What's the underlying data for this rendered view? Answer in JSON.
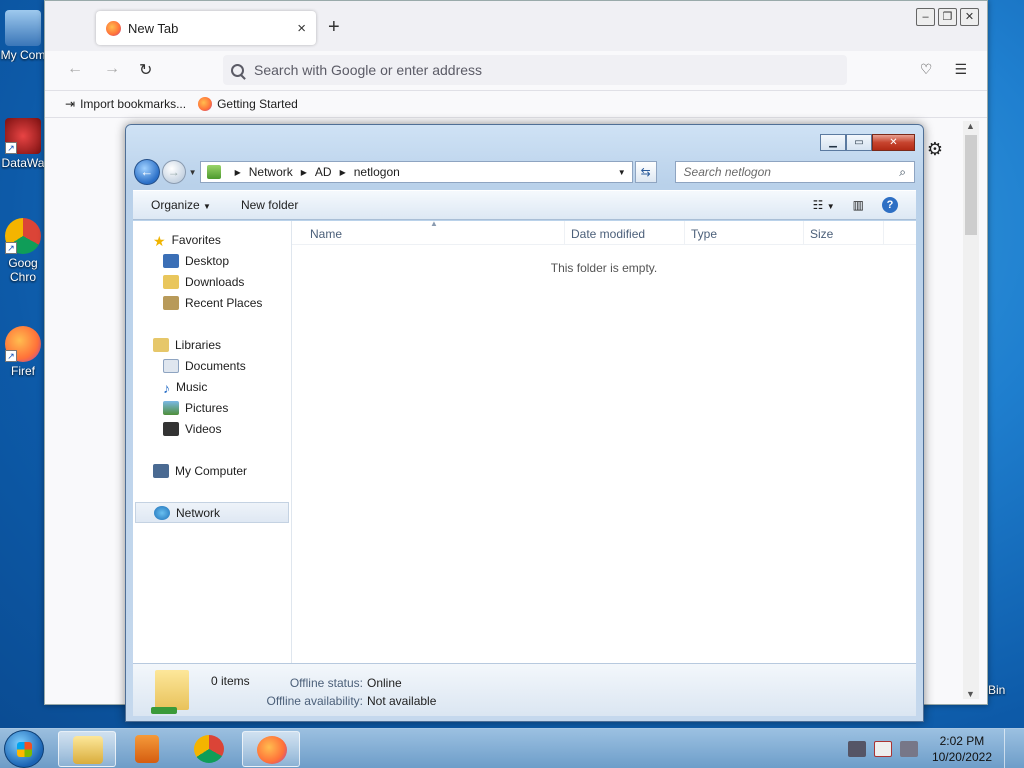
{
  "desktop": {
    "icons": [
      {
        "label": "My Com"
      },
      {
        "label": "DataWa"
      },
      {
        "label": "Goog",
        "label2": "Chro"
      },
      {
        "label": "Firef"
      }
    ],
    "recycle_bin_label": "Bin"
  },
  "firefox": {
    "tab_title": "New Tab",
    "tab_close": "×",
    "new_tab": "+",
    "url_placeholder": "Search with Google or enter address",
    "bookmarks": [
      "Import bookmarks...",
      "Getting Started"
    ]
  },
  "explorer": {
    "breadcrumb": [
      "Network",
      "AD",
      "netlogon"
    ],
    "search_placeholder": "Search netlogon",
    "toolbar": {
      "organize": "Organize",
      "new_folder": "New folder"
    },
    "nav": {
      "favorites": "Favorites",
      "favorites_items": [
        "Desktop",
        "Downloads",
        "Recent Places"
      ],
      "libraries": "Libraries",
      "libraries_items": [
        "Documents",
        "Music",
        "Pictures",
        "Videos"
      ],
      "my_computer": "My Computer",
      "network": "Network"
    },
    "columns": {
      "name": "Name",
      "date": "Date modified",
      "type": "Type",
      "size": "Size"
    },
    "empty_message": "This folder is empty.",
    "details": {
      "items": "0 items",
      "offline_status_key": "Offline status:",
      "offline_status_val": "Online",
      "offline_avail_key": "Offline availability:",
      "offline_avail_val": "Not available"
    }
  },
  "taskbar": {
    "time": "2:02 PM",
    "date": "10/20/2022"
  }
}
